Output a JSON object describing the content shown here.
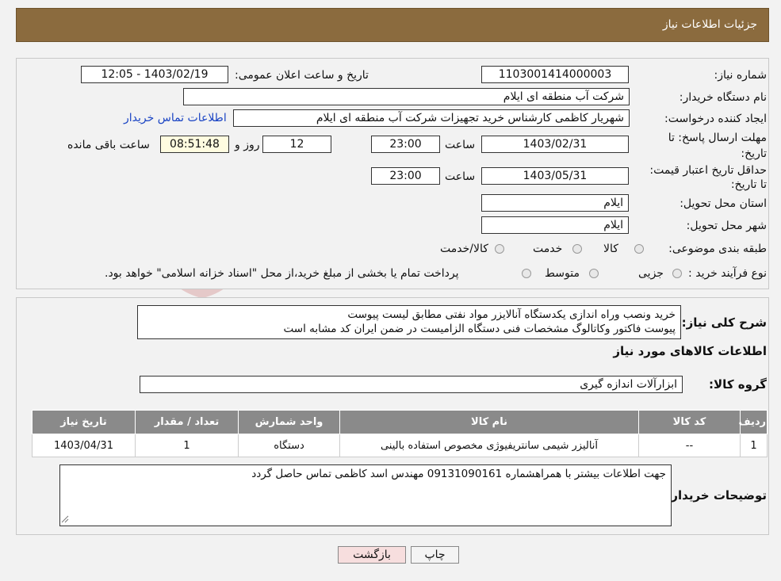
{
  "header": {
    "title": "جزئیات اطلاعات نیاز"
  },
  "form": {
    "need_number_label": "شماره نیاز:",
    "need_number": "1103001414000003",
    "announce_label": "تاریخ و ساعت اعلان عمومی:",
    "announce_value": "1403/02/19 - 12:05",
    "buyer_org_label": "نام دستگاه خریدار:",
    "buyer_org": "شرکت آب منطقه ای ایلام",
    "creator_label": "ایجاد کننده درخواست:",
    "creator": "شهریار کاظمی کارشناس خرید تجهیزات شرکت آب منطقه ای ایلام",
    "contact_link": "اطلاعات تماس خریدار",
    "deadline_label": "مهلت ارسال پاسخ: تا تاریخ:",
    "deadline_date": "1403/02/31",
    "time_label": "ساعت",
    "deadline_time": "23:00",
    "days": "12",
    "days_label": "روز و",
    "remaining": "08:51:48",
    "remaining_label": "ساعت باقی مانده",
    "validity_label": "حداقل تاریخ اعتبار قیمت: تا تاریخ:",
    "validity_date": "1403/05/31",
    "validity_time": "23:00",
    "province_label": "استان محل تحویل:",
    "province": "ایلام",
    "city_label": "شهر محل تحویل:",
    "city": "ایلام",
    "category_label": "طبقه بندی موضوعی:",
    "category_options": [
      "کالا",
      "خدمت",
      "کالا/خدمت"
    ],
    "process_label": "نوع فرآیند خرید :",
    "process_options": [
      "جزیی",
      "متوسط"
    ],
    "process_note": "پرداخت تمام یا بخشی از مبلغ خرید،از محل \"اسناد خزانه اسلامی\" خواهد بود."
  },
  "description": {
    "label": "شرح کلی نیاز:",
    "line1": "خرید ونصب وراه اندازی یکدستگاه آنالایزر مواد نفتی مطابق لیست پیوست",
    "line2": "پیوست فاکتور وکاتالوگ مشخصات فنی دستگاه  الزامیست  در ضمن ایران کد مشابه است"
  },
  "goods": {
    "section_title": "اطلاعات کالاهای مورد نیاز",
    "group_label": "گروه کالا:",
    "group_value": "ابزارآلات اندازه گیری",
    "columns": [
      "ردیف",
      "کد کالا",
      "نام کالا",
      "واحد شمارش",
      "تعداد / مقدار",
      "تاریخ نیاز"
    ],
    "rows": [
      [
        "1",
        "--",
        "آنالیزر شیمی سانتریفیوژی مخصوص استفاده بالینی",
        "دستگاه",
        "1",
        "1403/04/31"
      ]
    ]
  },
  "buyer_notes": {
    "label": "توضیحات خریدار:",
    "text": "جهت اطلاعات بیشتر با همراهشماره 09131090161 مهندس اسد کاظمی تماس حاصل گردد"
  },
  "buttons": {
    "print": "چاپ",
    "back": "بازگشت"
  },
  "colors": {
    "header": "#8b6b3e",
    "table_header": "#8a8a8a",
    "back_button": "#f7dede",
    "link": "#1a44c4"
  }
}
